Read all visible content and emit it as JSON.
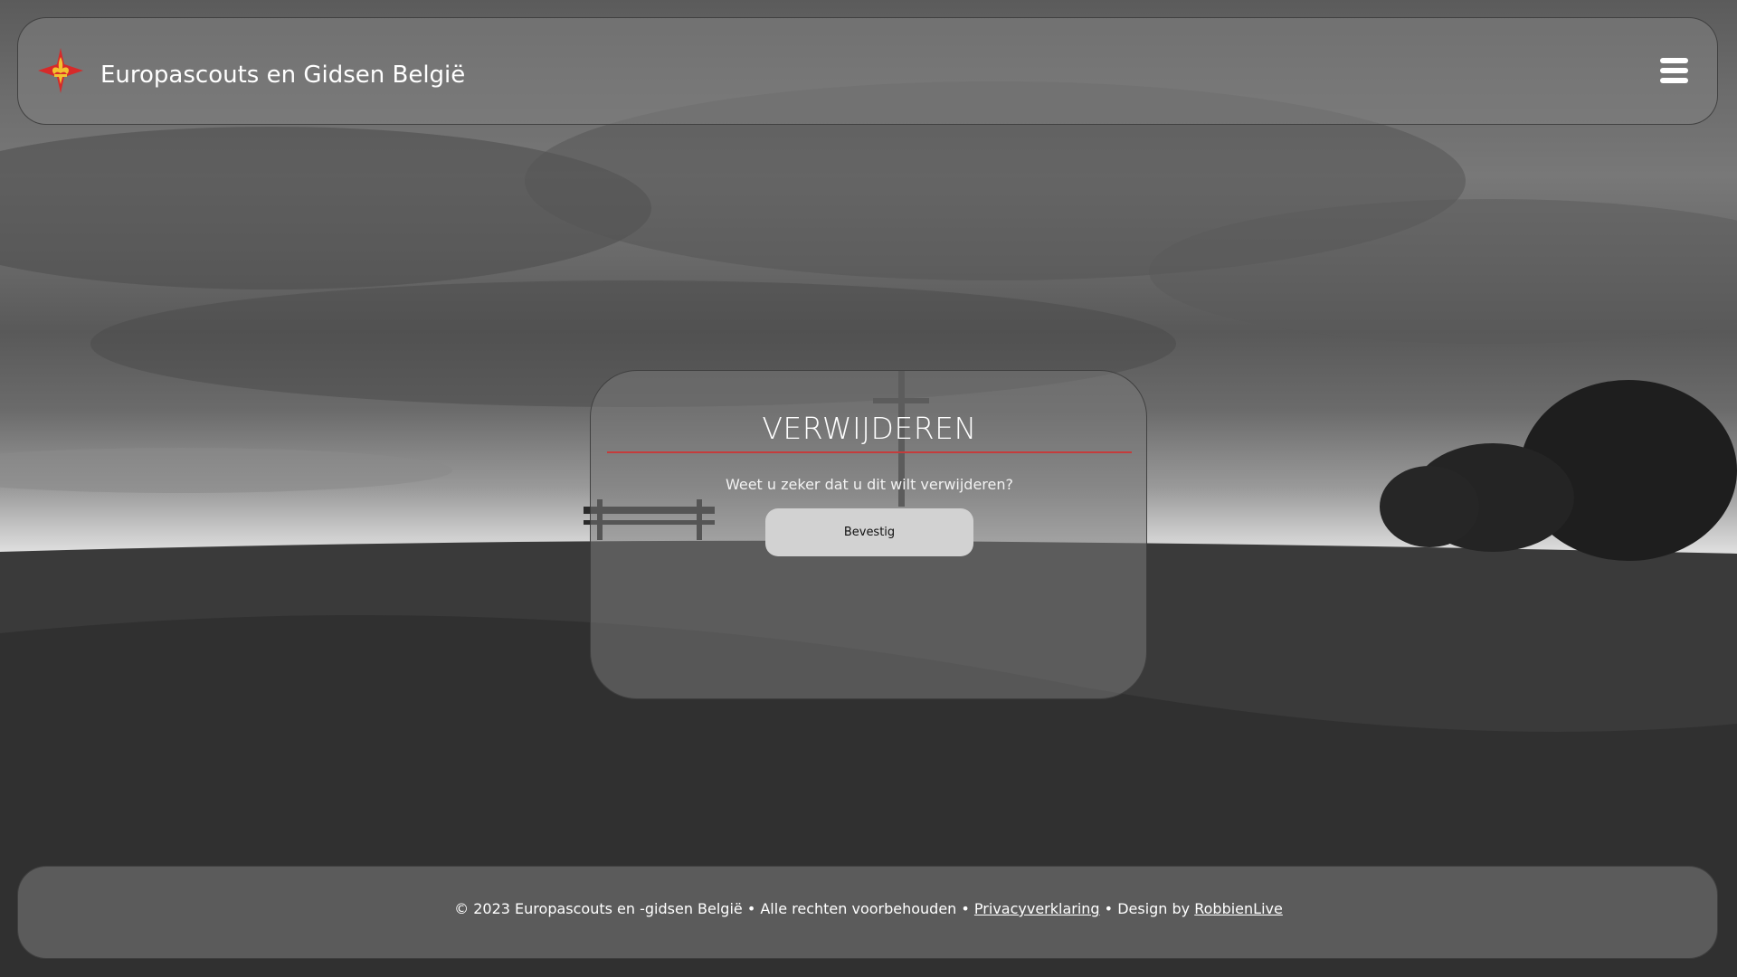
{
  "header": {
    "logo_icon": "scout-fleur-de-lis-cross-icon",
    "site_title": "Europascouts en Gidsen België",
    "menu_icon": "hamburger-menu-icon"
  },
  "dialog": {
    "title": "VERWIJDEREN",
    "message": "Weet u zeker dat u dit wilt verwijderen?",
    "confirm_label": "Bevestig"
  },
  "footer": {
    "copyright": "© 2023 Europascouts en -gidsen België • Alle rechten voorbehouden • ",
    "privacy_link": "Privacyverklaring",
    "design_prefix": " • Design by ",
    "designer_link": "RobbienLive"
  },
  "colors": {
    "accent_underline": "#c43c3c",
    "logo_red": "#d62a2a",
    "logo_gold": "#f2c230",
    "button_bg": "#d2d2d2"
  }
}
